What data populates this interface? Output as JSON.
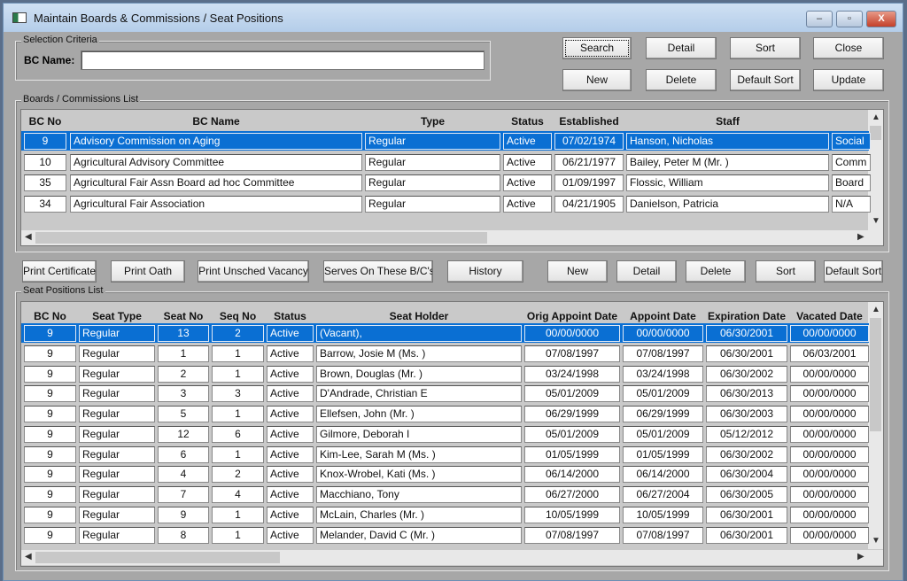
{
  "window": {
    "title": "Maintain Boards & Commissions / Seat Positions",
    "minimize": "–",
    "maximize": "▫",
    "close": "X"
  },
  "selection": {
    "group_label": "Selection Criteria",
    "bc_name_label": "BC Name:",
    "bc_name_value": ""
  },
  "top_buttons": {
    "search": "Search",
    "detail": "Detail",
    "sort": "Sort",
    "close": "Close",
    "new": "New",
    "delete": "Delete",
    "default_sort": "Default Sort",
    "update": "Update"
  },
  "boards": {
    "group_label": "Boards / Commissions List",
    "columns": [
      "BC No",
      "BC Name",
      "Type",
      "Status",
      "Established",
      "Staff"
    ],
    "rows": [
      [
        "9",
        "Advisory Commission on Aging",
        "Regular",
        "Active",
        "07/02/1974",
        "Hanson, Nicholas",
        "Social"
      ],
      [
        "10",
        "Agricultural Advisory Committee",
        "Regular",
        "Active",
        "06/21/1977",
        "Bailey, Peter M (Mr. )",
        "Comm"
      ],
      [
        "35",
        "Agricultural Fair Assn Board ad hoc Committee",
        "Regular",
        "Active",
        "01/09/1997",
        "Flossic, William",
        "Board"
      ],
      [
        "34",
        "Agricultural Fair Association",
        "Regular",
        "Active",
        "04/21/1905",
        "Danielson, Patricia",
        "N/A"
      ]
    ],
    "selected_row": 0
  },
  "mid_buttons": {
    "print_certificate": "Print Certificate",
    "print_oath": "Print Oath",
    "print_unsched": "Print Unsched Vacancy",
    "serves_on": "Serves On These B/C's",
    "history": "History",
    "new": "New",
    "detail": "Detail",
    "delete": "Delete",
    "sort": "Sort",
    "default_sort": "Default Sort"
  },
  "seats": {
    "group_label": "Seat Positions List",
    "columns": [
      "BC No",
      "Seat Type",
      "Seat No",
      "Seq No",
      "Status",
      "Seat Holder",
      "Orig Appoint Date",
      "Appoint Date",
      "Expiration Date",
      "Vacated Date"
    ],
    "rows": [
      [
        "9",
        "Regular",
        "13",
        "2",
        "Active",
        "(Vacant),",
        "00/00/0000",
        "00/00/0000",
        "06/30/2001",
        "00/00/0000"
      ],
      [
        "9",
        "Regular",
        "1",
        "1",
        "Active",
        "Barrow, Josie M (Ms. )",
        "07/08/1997",
        "07/08/1997",
        "06/30/2001",
        "06/03/2001"
      ],
      [
        "9",
        "Regular",
        "2",
        "1",
        "Active",
        "Brown, Douglas  (Mr. )",
        "03/24/1998",
        "03/24/1998",
        "06/30/2002",
        "00/00/0000"
      ],
      [
        "9",
        "Regular",
        "3",
        "3",
        "Active",
        "D'Andrade, Christian E",
        "05/01/2009",
        "05/01/2009",
        "06/30/2013",
        "00/00/0000"
      ],
      [
        "9",
        "Regular",
        "5",
        "1",
        "Active",
        "Ellefsen, John  (Mr. )",
        "06/29/1999",
        "06/29/1999",
        "06/30/2003",
        "00/00/0000"
      ],
      [
        "9",
        "Regular",
        "12",
        "6",
        "Active",
        "Gilmore, Deborah I",
        "05/01/2009",
        "05/01/2009",
        "05/12/2012",
        "00/00/0000"
      ],
      [
        "9",
        "Regular",
        "6",
        "1",
        "Active",
        "Kim-Lee, Sarah M (Ms. )",
        "01/05/1999",
        "01/05/1999",
        "06/30/2002",
        "00/00/0000"
      ],
      [
        "9",
        "Regular",
        "4",
        "2",
        "Active",
        "Knox-Wrobel, Kati  (Ms. )",
        "06/14/2000",
        "06/14/2000",
        "06/30/2004",
        "00/00/0000"
      ],
      [
        "9",
        "Regular",
        "7",
        "4",
        "Active",
        "Macchiano, Tony",
        "06/27/2000",
        "06/27/2004",
        "06/30/2005",
        "00/00/0000"
      ],
      [
        "9",
        "Regular",
        "9",
        "1",
        "Active",
        "McLain, Charles  (Mr. )",
        "10/05/1999",
        "10/05/1999",
        "06/30/2001",
        "00/00/0000"
      ],
      [
        "9",
        "Regular",
        "8",
        "1",
        "Active",
        "Melander, David C (Mr. )",
        "07/08/1997",
        "07/08/1997",
        "06/30/2001",
        "00/00/0000"
      ]
    ],
    "selected_row": 0
  },
  "colors": {
    "selection": "#0a6fd3",
    "window_bg": "#a7a7a7"
  }
}
